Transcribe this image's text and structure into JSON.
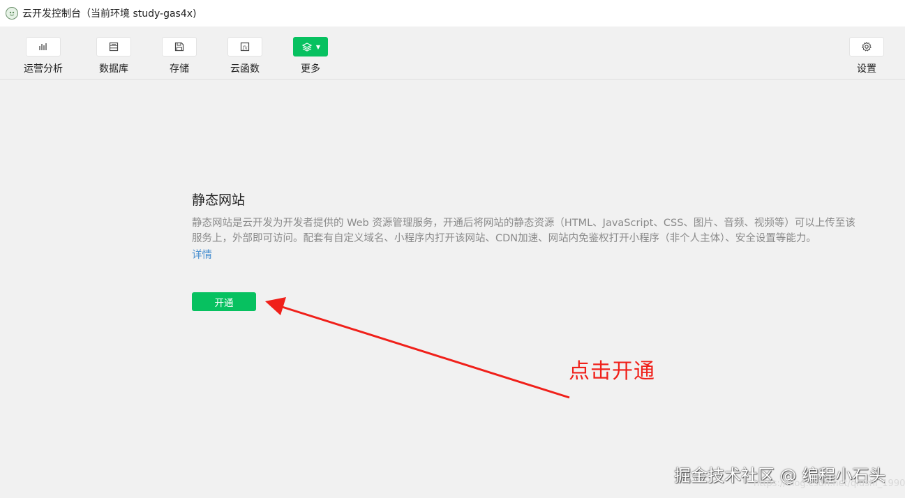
{
  "window": {
    "title": "云开发控制台（当前环境 study-gas4x)"
  },
  "toolbar": {
    "items": [
      {
        "label": "运营分析",
        "icon": "bar-chart-icon"
      },
      {
        "label": "数据库",
        "icon": "database-icon"
      },
      {
        "label": "存储",
        "icon": "save-icon"
      },
      {
        "label": "云函数",
        "icon": "function-icon"
      },
      {
        "label": "更多",
        "icon": "layers-icon"
      }
    ],
    "settings": {
      "label": "设置",
      "icon": "gear-icon"
    }
  },
  "main": {
    "title": "静态网站",
    "description": "静态网站是云开发为开发者提供的 Web 资源管理服务，开通后将网站的静态资源（HTML、JavaScript、CSS、图片、音频、视频等）可以上传至该服务上，外部即可访问。配套有自定义域名、小程序内打开该网站、CDN加速、网站内免鉴权打开小程序（非个人主体）、安全设置等能力。",
    "detail_link": "详情",
    "open_button": "开通"
  },
  "annotation": {
    "text": "点击开通",
    "color": "#f0201a"
  },
  "watermark": {
    "text": "掘金技术社区 @ 编程小石头",
    "url": "https://blog.csdn.net/qiushi_1990"
  },
  "colors": {
    "accent": "#07c160",
    "link": "#4a90d0"
  }
}
